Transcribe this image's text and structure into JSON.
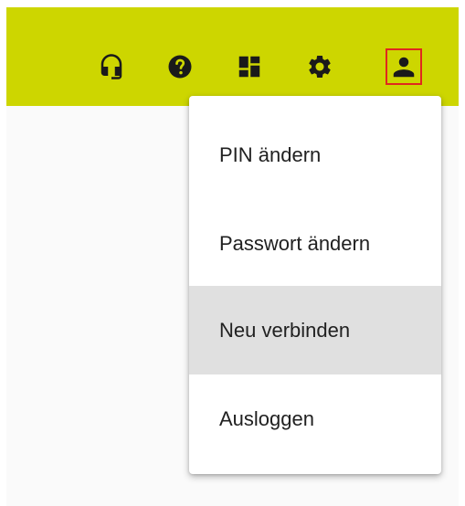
{
  "toolbar": {
    "background_color": "#cdd600",
    "icons": [
      {
        "name": "headset-icon"
      },
      {
        "name": "help-icon"
      },
      {
        "name": "dashboard-icon"
      },
      {
        "name": "settings-icon"
      },
      {
        "name": "account-icon",
        "selected": true
      }
    ]
  },
  "colors": {
    "highlight_border": "#e0281e",
    "menu_hover": "#e0e0e0"
  },
  "user_menu": {
    "items": [
      {
        "label": "PIN ändern"
      },
      {
        "label": "Passwort ändern"
      },
      {
        "label": "Neu verbinden",
        "highlighted": true
      },
      {
        "label": "Ausloggen"
      }
    ]
  }
}
